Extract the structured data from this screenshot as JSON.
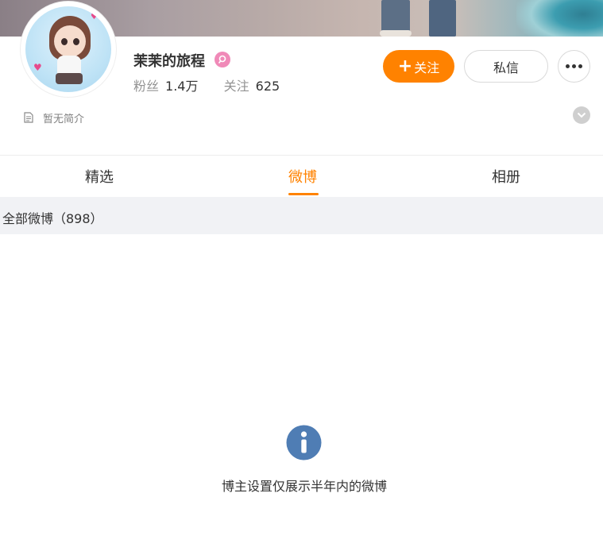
{
  "profile": {
    "name": "茉茉的旅程",
    "fans_label": "粉丝",
    "fans_count": "1.4万",
    "following_label": "关注",
    "following_count": "625",
    "bio": "暂无简介"
  },
  "actions": {
    "follow_plus": "+",
    "follow_label": "关注",
    "message_label": "私信"
  },
  "tabs": [
    {
      "label": "精选"
    },
    {
      "label": "微博",
      "active": true
    },
    {
      "label": "相册"
    }
  ],
  "section": {
    "title": "全部微博（898）"
  },
  "empty_state": {
    "message": "博主设置仅展示半年内的微博"
  },
  "colors": {
    "accent": "#ff8200",
    "info": "#4f7db4",
    "section_bg": "#f1f2f5"
  },
  "icons": [
    "vip-badge-icon",
    "document-icon",
    "chevron-down-icon",
    "more-dots-icon",
    "info-icon"
  ]
}
